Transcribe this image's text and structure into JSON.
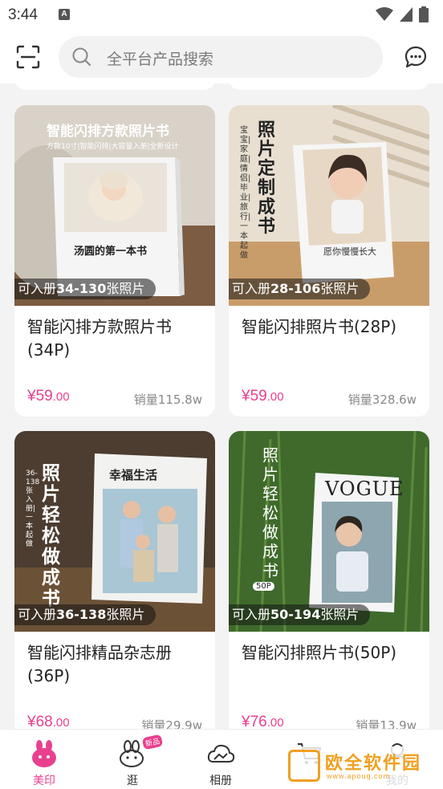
{
  "status_bar": {
    "time": "3:44",
    "notification_letter": "A"
  },
  "header": {
    "search_placeholder": "全平台产品搜索"
  },
  "products": [
    {
      "badge_prefix": "可入册",
      "badge_range": "34-130",
      "badge_suffix": "张照片",
      "title": "智能闪排方款照片书(34P)",
      "price_int": "¥59",
      "price_dec": ".00",
      "sales": "销量115.8w",
      "image": {
        "heading": "智能闪排方款照片书",
        "sub": "方款10寸|智能闪排|大容量入册|全新设计",
        "caption": "汤圆的第一本书"
      }
    },
    {
      "badge_prefix": "可入册",
      "badge_range": "28-106",
      "badge_suffix": "张照片",
      "title": "智能闪排照片书(28P)",
      "price_int": "¥59",
      "price_dec": ".00",
      "sales": "销量328.6w",
      "image": {
        "heading": "照片定制成书",
        "sub": "宝宝|家庭|情侣|毕业|旅行|一本起做",
        "caption": "愿你慢慢长大"
      }
    },
    {
      "badge_prefix": "可入册",
      "badge_range": "36-138",
      "badge_suffix": "张照片",
      "title": "智能闪排精品杂志册(36P)",
      "price_int": "¥68",
      "price_dec": ".00",
      "sales": "销量29.9w",
      "image": {
        "heading": "照片轻松做成书",
        "sub": "36-138张入册|一本起做",
        "caption": "幸福生活"
      }
    },
    {
      "badge_prefix": "可入册",
      "badge_range": "50-194",
      "badge_suffix": "张照片",
      "title": "智能闪排照片书(50P)",
      "price_int": "¥76",
      "price_dec": ".00",
      "sales": "销量13.9w",
      "image": {
        "heading": "照片轻松做成书",
        "sub": "50P",
        "caption": "VOGUE"
      }
    }
  ],
  "bottom_nav": [
    {
      "label": "美印",
      "icon": "rabbit-home-icon",
      "active": true
    },
    {
      "label": "逛",
      "icon": "rabbit-browse-icon",
      "badge": "新品"
    },
    {
      "label": "相册",
      "icon": "cloud-album-icon"
    },
    {
      "label": "",
      "icon": "cart-icon"
    },
    {
      "label": "我的",
      "icon": "profile-icon"
    }
  ],
  "watermark": {
    "text": "欧全软件园",
    "url": "www.apouq.com"
  },
  "colors": {
    "accent": "#e8408f",
    "watermark": "#f0a020"
  }
}
